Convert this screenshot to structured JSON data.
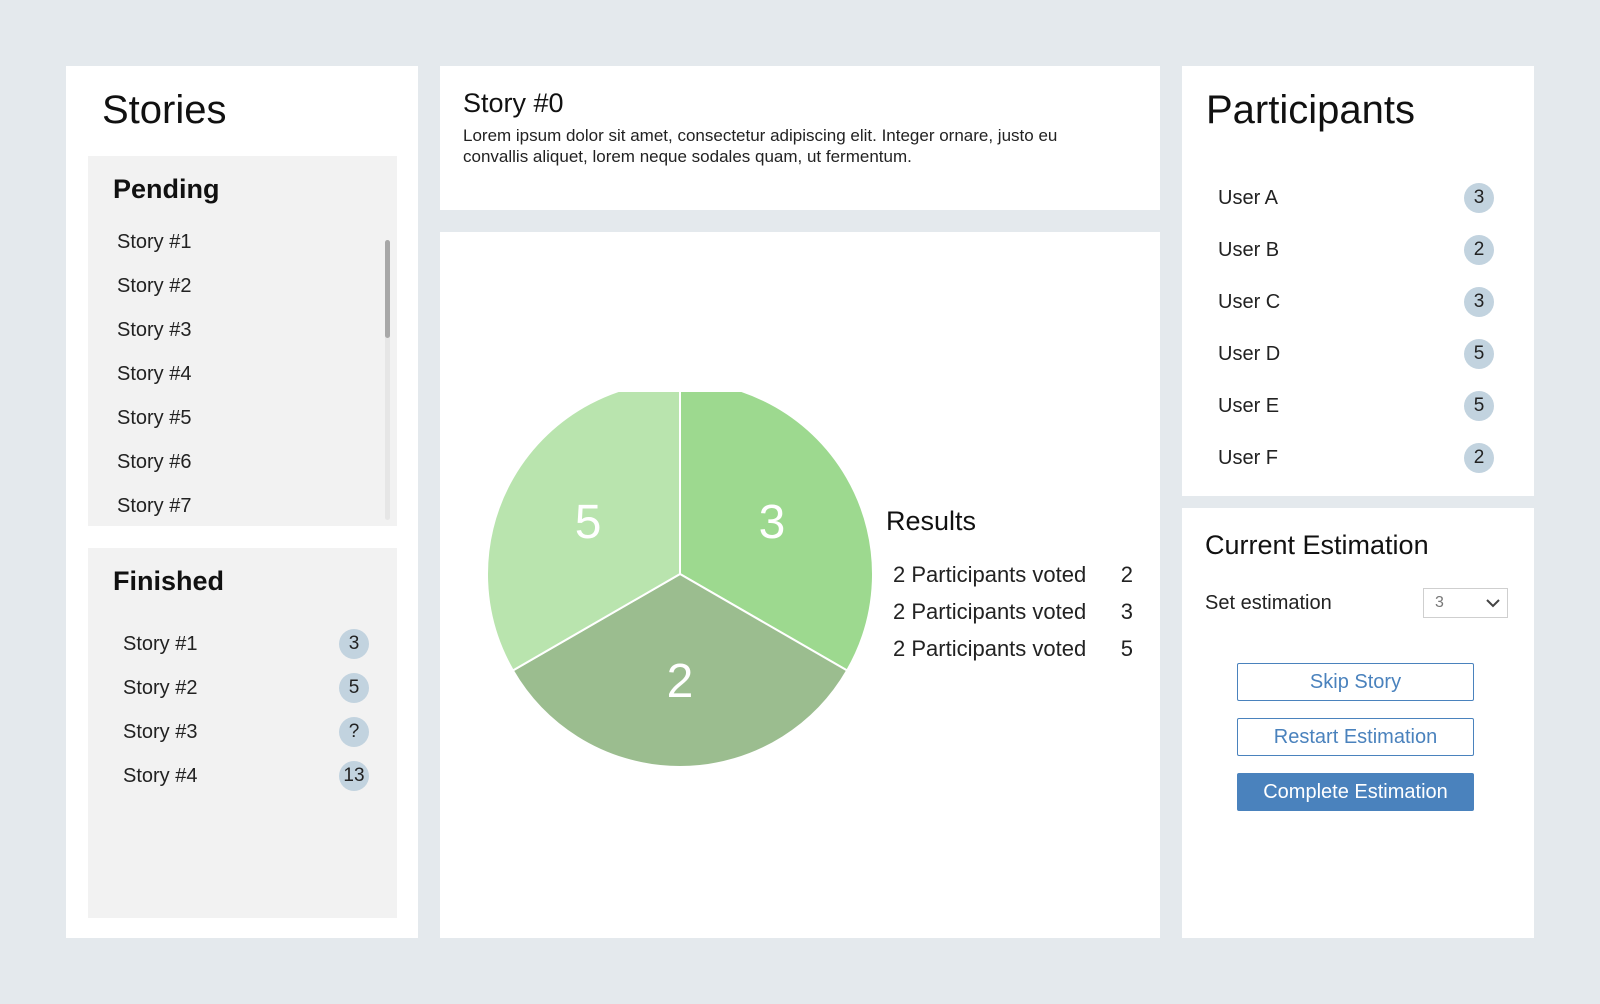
{
  "stories": {
    "title": "Stories",
    "pending": {
      "title": "Pending",
      "items": [
        "Story #1",
        "Story #2",
        "Story #3",
        "Story #4",
        "Story #5",
        "Story #6",
        "Story #7"
      ]
    },
    "finished": {
      "title": "Finished",
      "items": [
        {
          "label": "Story #1",
          "estimate": "3"
        },
        {
          "label": "Story #2",
          "estimate": "5"
        },
        {
          "label": "Story #3",
          "estimate": "?"
        },
        {
          "label": "Story #4",
          "estimate": "13"
        }
      ]
    }
  },
  "story": {
    "title": "Story #0",
    "description": "Lorem ipsum dolor sit amet, consectetur adipiscing elit. Integer ornare, justo eu convallis aliquet, lorem neque sodales quam, ut fermentum."
  },
  "results": {
    "title": "Results",
    "rows": [
      {
        "label": "2 Participants voted",
        "value": "2"
      },
      {
        "label": "2 Participants voted",
        "value": "3"
      },
      {
        "label": "2 Participants voted",
        "value": "5"
      }
    ]
  },
  "chart_data": {
    "type": "pie",
    "slices": [
      {
        "label": "3",
        "value": 2,
        "color": "#9dd98f"
      },
      {
        "label": "2",
        "value": 2,
        "color": "#9bbd8f"
      },
      {
        "label": "5",
        "value": 2,
        "color": "#b9e4ae"
      }
    ]
  },
  "participants": {
    "title": "Participants",
    "users": [
      {
        "name": "User A",
        "vote": "3"
      },
      {
        "name": "User B",
        "vote": "2"
      },
      {
        "name": "User C",
        "vote": "3"
      },
      {
        "name": "User D",
        "vote": "5"
      },
      {
        "name": "User E",
        "vote": "5"
      },
      {
        "name": "User F",
        "vote": "2"
      }
    ]
  },
  "estimation": {
    "title": "Current Estimation",
    "set_label": "Set estimation",
    "selected_value": "3",
    "skip_label": "Skip Story",
    "restart_label": "Restart Estimation",
    "complete_label": "Complete Estimation"
  },
  "colors": {
    "accent": "#4a82bd",
    "badge": "#c2d3df",
    "background": "#e4e9ed"
  }
}
